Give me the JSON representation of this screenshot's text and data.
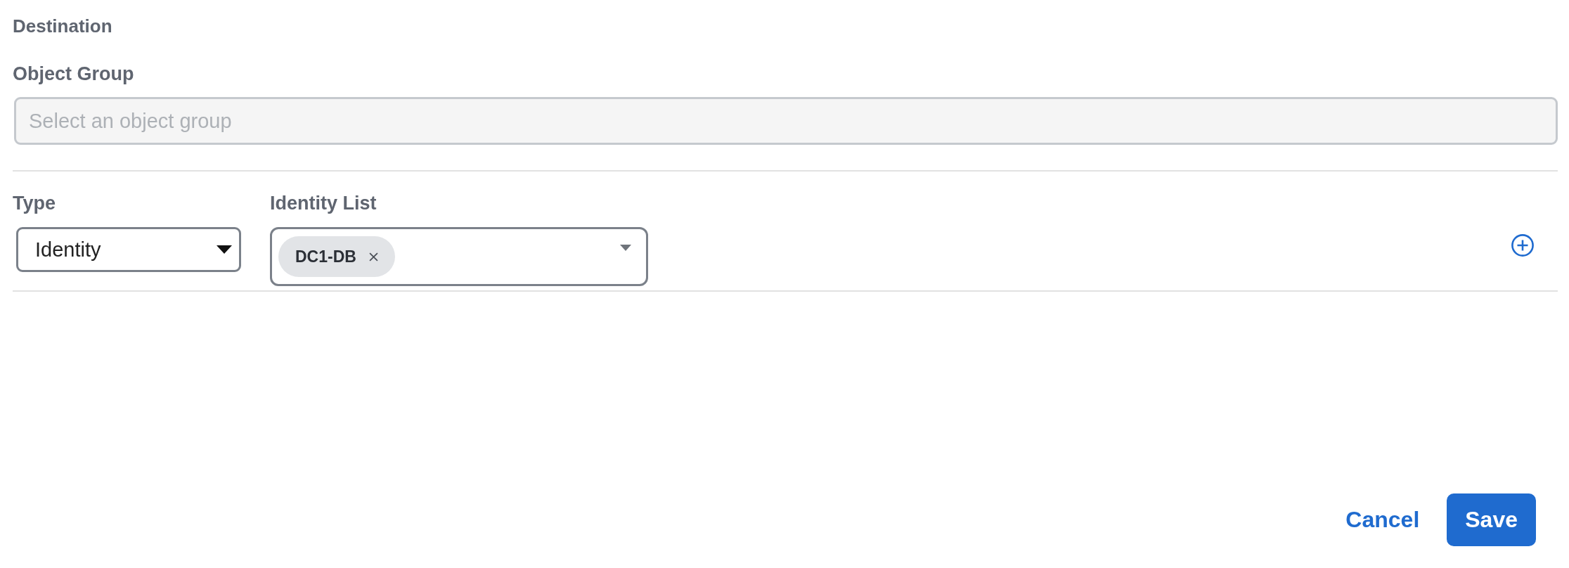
{
  "section_title": "Destination",
  "object_group": {
    "label": "Object Group",
    "placeholder": "Select an object group"
  },
  "rule_row": {
    "type": {
      "label": "Type",
      "value": "Identity"
    },
    "identity_list": {
      "label": "Identity List",
      "chips": [
        {
          "label": "DC1-DB"
        }
      ]
    }
  },
  "buttons": [
    {
      "label": "Cancel",
      "kind": "link"
    },
    {
      "label": "Save",
      "kind": "primary"
    }
  ]
}
